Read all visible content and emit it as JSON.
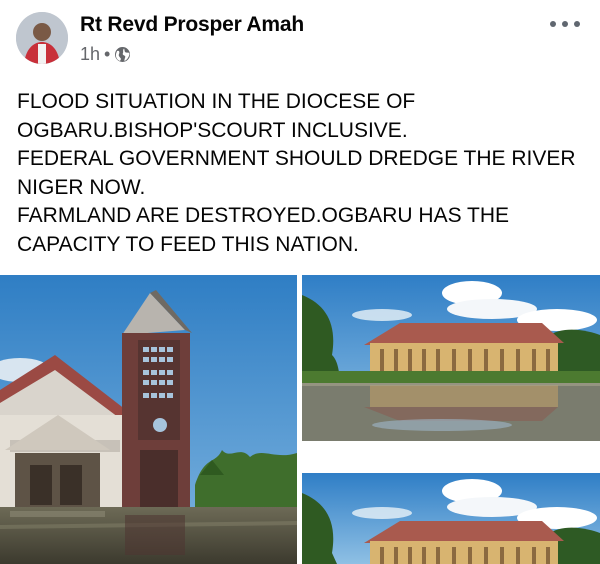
{
  "post": {
    "author": "Rt Revd Prosper Amah",
    "timestamp": "1h",
    "separator": "•",
    "privacy_icon": "globe-icon",
    "more_icon": "more-options-icon",
    "text_lines": [
      "FLOOD SITUATION IN THE DIOCESE OF",
      "OGBARU.BISHOP'SCOURT INCLUSIVE.",
      "FEDERAL GOVERNMENT SHOULD DREDGE THE RIVER",
      "NIGER NOW.",
      "FARMLAND ARE DESTROYED.OGBARU HAS THE",
      "CAPACITY TO FEED THIS NATION."
    ]
  },
  "photos": [
    {
      "name": "flooded-church-photo"
    },
    {
      "name": "flooded-building-photo"
    },
    {
      "name": "flooded-building-photo-2"
    }
  ],
  "colors": {
    "text": "#050505",
    "meta": "#65676b",
    "sky": "#3d86c6",
    "water": "#6b6a55"
  }
}
